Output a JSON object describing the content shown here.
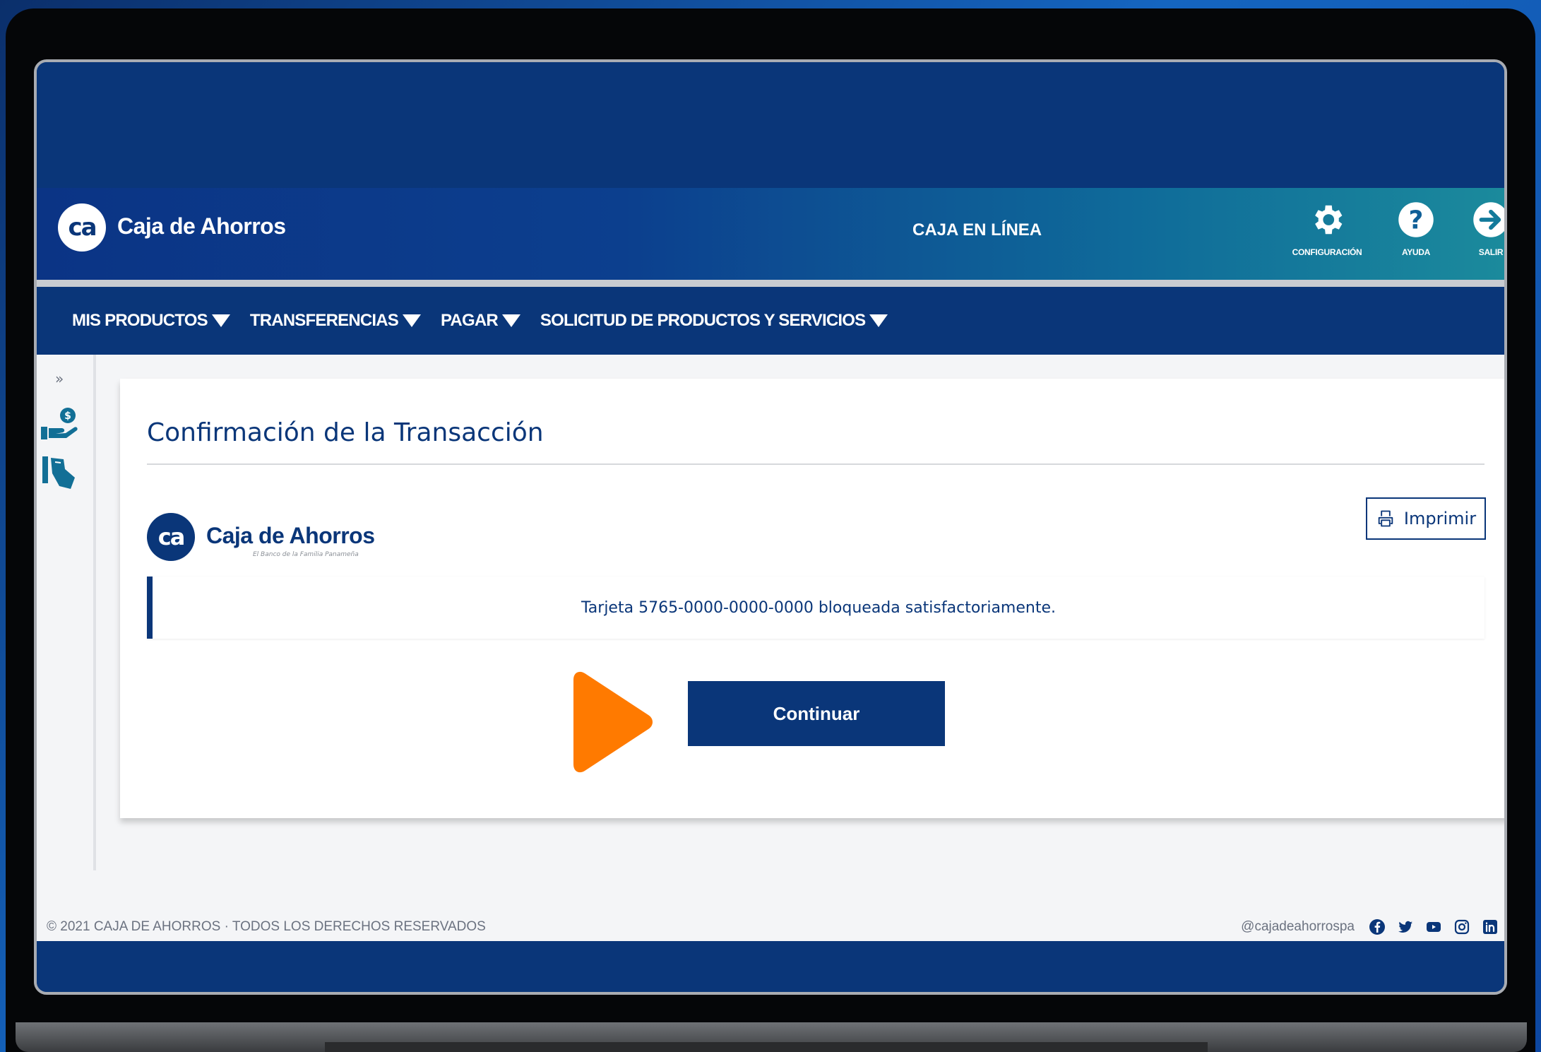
{
  "header": {
    "logo_mark": "ca",
    "brand": "Caja de Ahorros",
    "center_title": "CAJA EN LÍNEA",
    "actions": [
      {
        "label": "CONFIGURACIÓN",
        "icon": "gear-icon"
      },
      {
        "label": "AYUDA",
        "icon": "help-icon"
      },
      {
        "label": "SALIR",
        "icon": "logout-icon"
      }
    ]
  },
  "nav": {
    "items": [
      {
        "label": "MIS PRODUCTOS"
      },
      {
        "label": "TRANSFERENCIAS"
      },
      {
        "label": "PAGAR"
      },
      {
        "label": "SOLICITUD DE PRODUCTOS Y SERVICIOS"
      }
    ]
  },
  "sidebar": {
    "expand_label": "»",
    "icons": [
      "hand-coin-icon",
      "card-hand-icon"
    ]
  },
  "card": {
    "title": "Confirmación de la Transacción",
    "logo_mark": "ca",
    "brand": "Caja de Ahorros",
    "tagline": "El Banco de la Familia Panameña",
    "print_label": "Imprimir",
    "alert_message": "Tarjeta 5765-0000-0000-0000 bloqueada satisfactoriamente.",
    "continue_label": "Continuar"
  },
  "footer": {
    "copyright": "© 2021 CAJA DE AHORROS · TODOS LOS DERECHOS RESERVADOS",
    "social_handle": "@cajadeahorrospa",
    "social_icons": [
      "facebook-icon",
      "twitter-icon",
      "youtube-icon",
      "instagram-icon",
      "linkedin-icon"
    ]
  },
  "colors": {
    "brand_navy": "#0a3679",
    "play_orange": "#ff7a00",
    "header_teal": "#1b8a9c"
  }
}
